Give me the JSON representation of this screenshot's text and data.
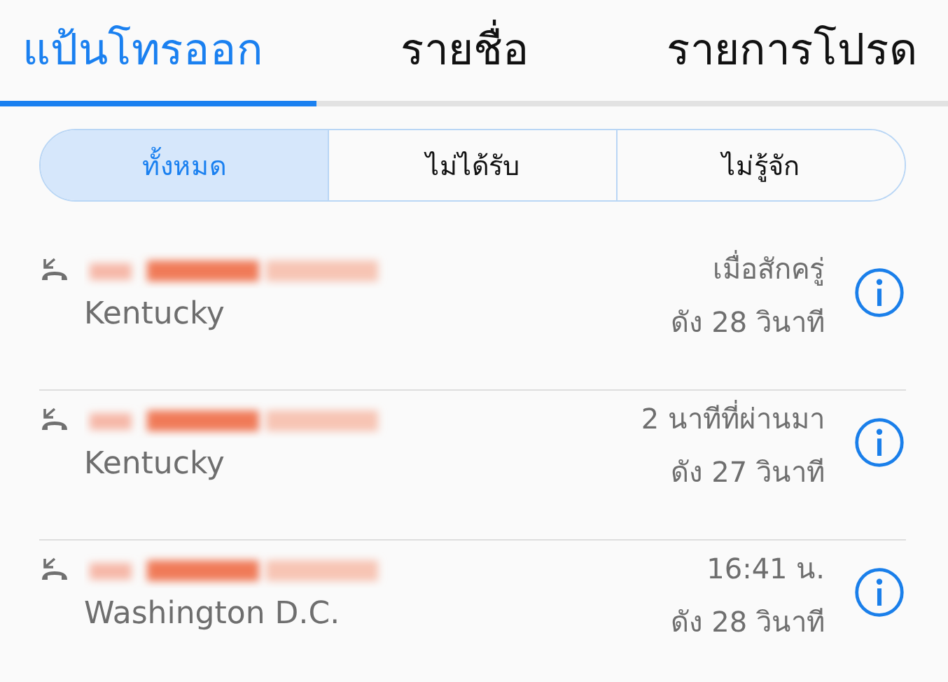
{
  "tabs": [
    {
      "label": "แป้นโทรออก",
      "selected": true
    },
    {
      "label": "รายชื่อ",
      "selected": false
    },
    {
      "label": "รายการโปรด",
      "selected": false
    }
  ],
  "filters": [
    {
      "label": "ทั้งหมด",
      "selected": true
    },
    {
      "label": "ไม่ได้รับ",
      "selected": false
    },
    {
      "label": "ไม่รู้จัก",
      "selected": false
    }
  ],
  "calls": [
    {
      "location": "Kentucky",
      "time": "เมื่อสักครู่",
      "duration": "ดัง 28 วินาที"
    },
    {
      "location": "Kentucky",
      "time": "2 นาทีที่ผ่านมา",
      "duration": "ดัง 27 วินาที"
    },
    {
      "location": "Washington D.C.",
      "time": "16:41 น.",
      "duration": "ดัง 28 วินาที"
    }
  ]
}
